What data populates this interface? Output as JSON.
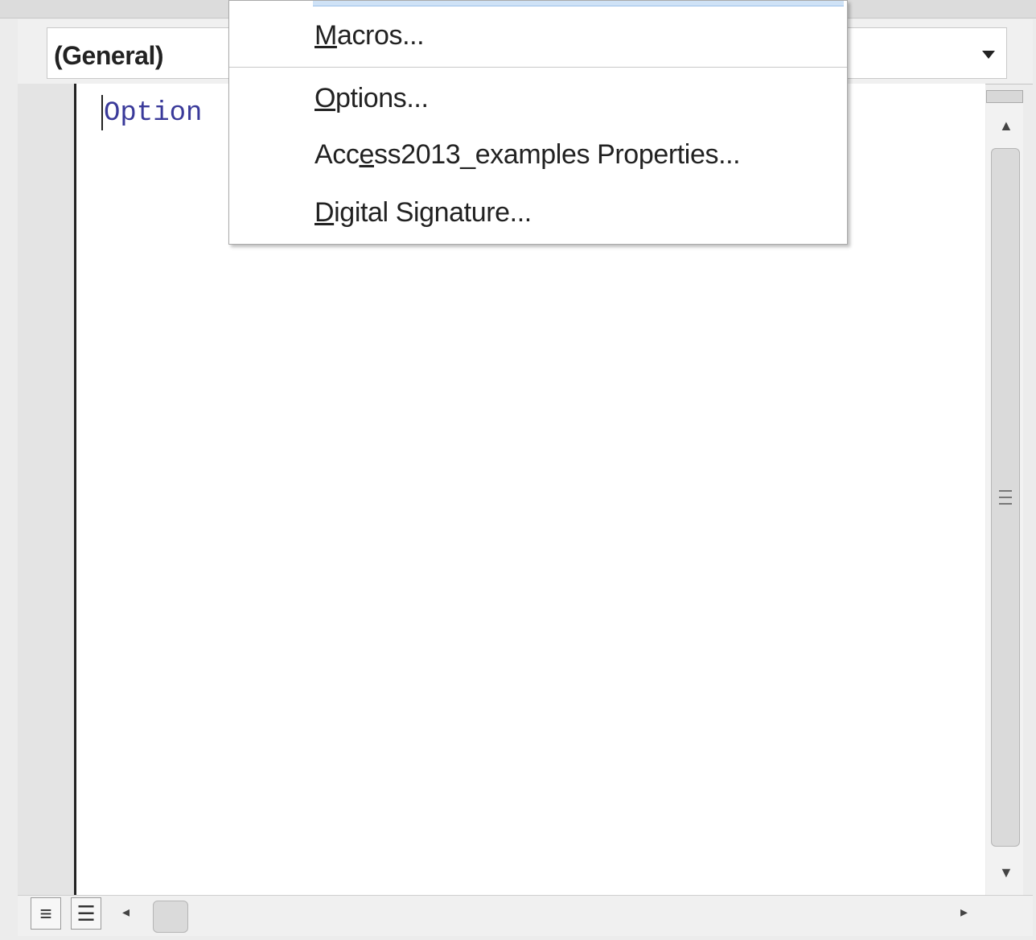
{
  "object_combo": {
    "value": "(General)"
  },
  "code": {
    "first_line": "Option"
  },
  "menu": {
    "items": [
      {
        "label": "Macros...",
        "accelerator": "M"
      },
      {
        "label": "Options...",
        "accelerator": "O"
      },
      {
        "label": "Access2013_examples Properties...",
        "accelerator": "e"
      },
      {
        "label": "Digital Signature...",
        "accelerator": "D"
      }
    ]
  },
  "view_buttons": {
    "procedure": "≡",
    "full_module": "☰"
  },
  "icons": {
    "dropdown": "chevron-down-icon",
    "scroll_up": "arrow-up-icon",
    "scroll_down": "arrow-down-icon",
    "scroll_left": "arrow-left-icon",
    "scroll_right": "arrow-right-icon"
  },
  "colors": {
    "code_text": "#3a3a9a",
    "menu_highlight": "#cfe2f6"
  }
}
